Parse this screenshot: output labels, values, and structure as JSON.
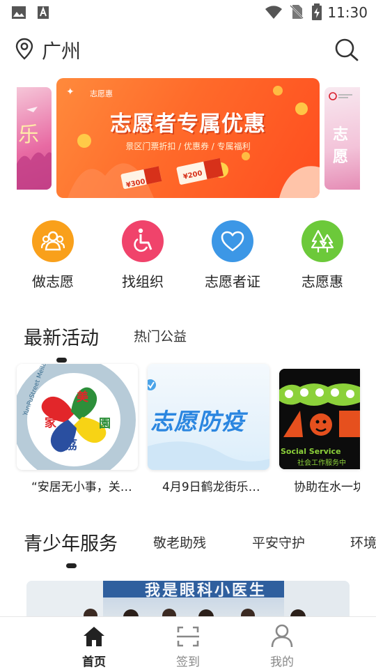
{
  "status_bar": {
    "time": "11:30"
  },
  "header": {
    "city": "广州"
  },
  "banner": {
    "tag": "志愿惠",
    "title": "志愿者专属优惠",
    "subtitle": "景区门票折扣 / 优惠券 / 专属福利",
    "coupon_1": "¥300",
    "coupon_2": "¥200",
    "right_text": "志愿"
  },
  "quick_actions": [
    {
      "label": "做志愿",
      "color": "#f9a01b",
      "icon": "people-group-icon"
    },
    {
      "label": "找组织",
      "color": "#f0436b",
      "icon": "wheelchair-icon"
    },
    {
      "label": "志愿者证",
      "color": "#3c97e6",
      "icon": "heart-icon"
    },
    {
      "label": "志愿惠",
      "color": "#6cc93a",
      "icon": "tree-icon"
    }
  ],
  "activities_section": {
    "title": "最新活动",
    "tab_2": "热门公益",
    "items": [
      {
        "caption": "“安居无小事，关…",
        "badge": "美家荔园"
      },
      {
        "caption": "4月9日鹤龙街乐…",
        "badge": "志愿防疫"
      },
      {
        "caption": "协助在水一坊",
        "badge": "Social Service"
      }
    ],
    "logo_text": {
      "c1": "美",
      "c2": "園",
      "c3": "荔",
      "c4": "家",
      "ring": "YunPuStreet Meilai Home Socialwork Service Station"
    },
    "card3_sub": "社会工作服务中"
  },
  "youth_section": {
    "title": "青少年服务",
    "tabs": [
      "敬老助残",
      "平安守护",
      "环境"
    ],
    "photo_banner": "我是眼科小医生"
  },
  "tab_bar": {
    "items": [
      {
        "label": "首页",
        "active": true
      },
      {
        "label": "签到",
        "active": false
      },
      {
        "label": "我的",
        "active": false
      }
    ]
  }
}
